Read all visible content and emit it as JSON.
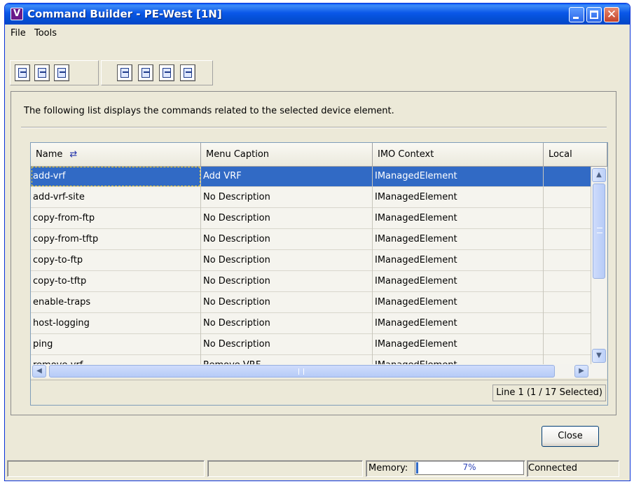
{
  "window": {
    "app_icon": "V",
    "title": "Command Builder - PE-West [1N]",
    "controls": {
      "minimize": "minimize-icon",
      "maximize": "maximize-icon",
      "close": "✕"
    }
  },
  "menu": {
    "items": [
      "File",
      "Tools"
    ]
  },
  "toolbar": {
    "group1": [
      "import-icon",
      "edit-icon",
      "delete-icon"
    ],
    "group2": [
      "export-icon",
      "run-icon",
      "view-icon",
      "deploy-icon"
    ]
  },
  "panel": {
    "description": "The following list displays the commands related to the selected device element."
  },
  "table": {
    "sort_indicator": "⇄",
    "columns": [
      "Name",
      "Menu Caption",
      "IMO Context",
      "Local"
    ],
    "rows": [
      [
        "add-vrf",
        "Add VRF",
        "IManagedElement",
        ""
      ],
      [
        "add-vrf-site",
        "No Description",
        "IManagedElement",
        ""
      ],
      [
        "copy-from-ftp",
        "No Description",
        "IManagedElement",
        ""
      ],
      [
        "copy-from-tftp",
        "No Description",
        "IManagedElement",
        ""
      ],
      [
        "copy-to-ftp",
        "No Description",
        "IManagedElement",
        ""
      ],
      [
        "copy-to-tftp",
        "No Description",
        "IManagedElement",
        ""
      ],
      [
        "enable-traps",
        "No Description",
        "IManagedElement",
        ""
      ],
      [
        "host-logging",
        "No Description",
        "IManagedElement",
        ""
      ],
      [
        "ping",
        "No Description",
        "IManagedElement",
        ""
      ],
      [
        "remove-vrf",
        "Remove VRF",
        "IManagedElement",
        ""
      ]
    ],
    "selected_row": 0,
    "line_info": "Line 1 (1 / 17 Selected)"
  },
  "buttons": {
    "close": "Close"
  },
  "statusbar": {
    "memory_label": "Memory:",
    "memory_value": "7%",
    "memory_fraction": 0.07,
    "connection": "Connected"
  },
  "colors": {
    "selection": "#316ac5",
    "titlebar": "#0a57e8",
    "window_bg": "#ece9d8"
  }
}
